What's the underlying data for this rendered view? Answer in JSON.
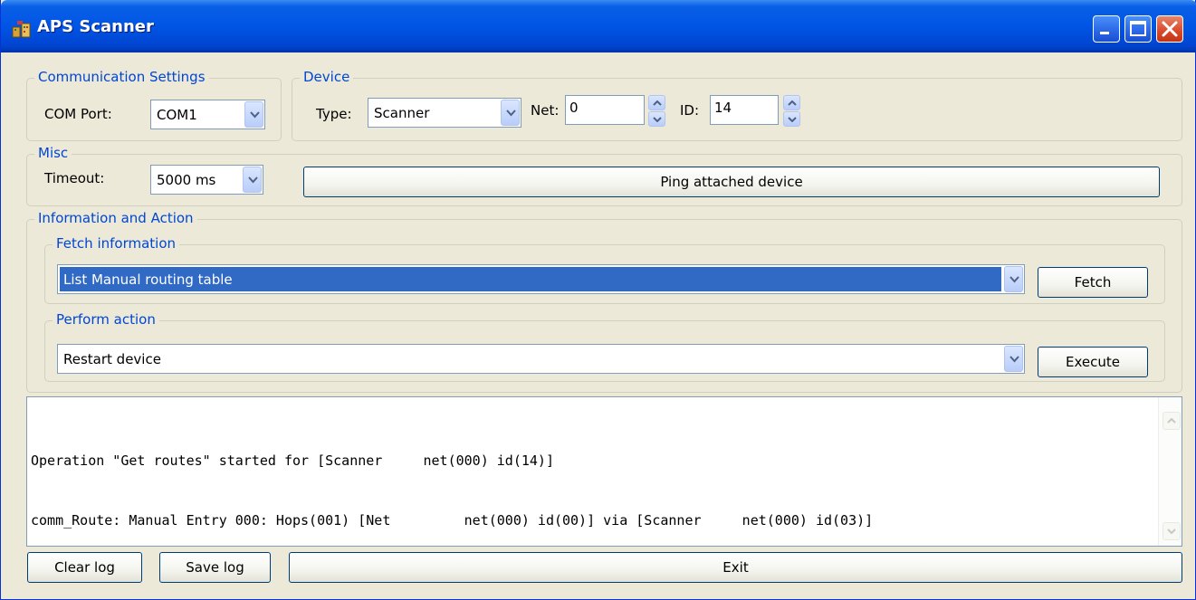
{
  "window": {
    "title": "APS Scanner"
  },
  "comm": {
    "legend": "Communication Settings",
    "port_label": "COM Port:",
    "port_value": "COM1"
  },
  "device": {
    "legend": "Device",
    "type_label": "Type:",
    "type_value": "Scanner",
    "net_label": "Net:",
    "net_value": "0",
    "id_label": "ID:",
    "id_value": "14"
  },
  "misc": {
    "legend": "Misc",
    "timeout_label": "Timeout:",
    "timeout_value": "5000 ms",
    "ping_label": "Ping attached device"
  },
  "info": {
    "legend": "Information and Action",
    "fetch_legend": "Fetch information",
    "fetch_value": "List Manual routing table",
    "fetch_button": "Fetch",
    "action_legend": "Perform action",
    "action_value": "Restart device",
    "execute_button": "Execute"
  },
  "log": {
    "lines": [
      "Operation \"Get routes\" started for [Scanner     net(000) id(14)]",
      "comm_Route: Manual Entry 000: Hops(001) [Net         net(000) id(00)] via [Scanner     net(000) id(03)]"
    ]
  },
  "footer": {
    "clear_label": "Clear log",
    "save_label": "Save log",
    "exit_label": "Exit"
  },
  "colors": {
    "titlebar": "#0055e5",
    "legend_text": "#0046d5",
    "selection": "#316ac5",
    "window_bg": "#ece9d8"
  },
  "icons": {
    "app": "app-icon",
    "minimize": "minimize-icon",
    "maximize": "maximize-icon",
    "close": "close-icon",
    "dropdown": "chevron-down-icon",
    "spin_up": "chevron-up-icon",
    "spin_down": "chevron-down-icon"
  }
}
